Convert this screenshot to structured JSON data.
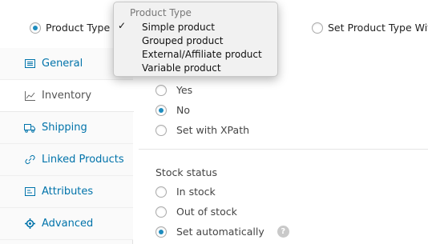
{
  "top_options": {
    "product_type": "Product Type",
    "set_product_type_with": "Set Product Type With"
  },
  "sidebar": {
    "items": [
      {
        "label": "General",
        "icon": "general-icon"
      },
      {
        "label": "Inventory",
        "icon": "inventory-icon"
      },
      {
        "label": "Shipping",
        "icon": "shipping-icon"
      },
      {
        "label": "Linked Products",
        "icon": "link-icon"
      },
      {
        "label": "Attributes",
        "icon": "attributes-icon"
      },
      {
        "label": "Advanced",
        "icon": "gear-icon"
      }
    ],
    "active": "Inventory"
  },
  "main": {
    "manage_stock_options": [
      "Yes",
      "No",
      "Set with XPath"
    ],
    "manage_stock_selected": "No",
    "stock_status": {
      "label": "Stock status",
      "options": [
        "In stock",
        "Out of stock",
        "Set automatically"
      ],
      "selected": "Set automatically",
      "help_icon": "?"
    }
  },
  "dropdown": {
    "header": "Product Type",
    "checkmark": "✓",
    "items": [
      "Simple product",
      "Grouped product",
      "External/Affiliate product",
      "Variable product"
    ],
    "selected": "Simple product"
  },
  "colors": {
    "accent": "#0073aa",
    "radio_dot": "#1e8cbe"
  }
}
